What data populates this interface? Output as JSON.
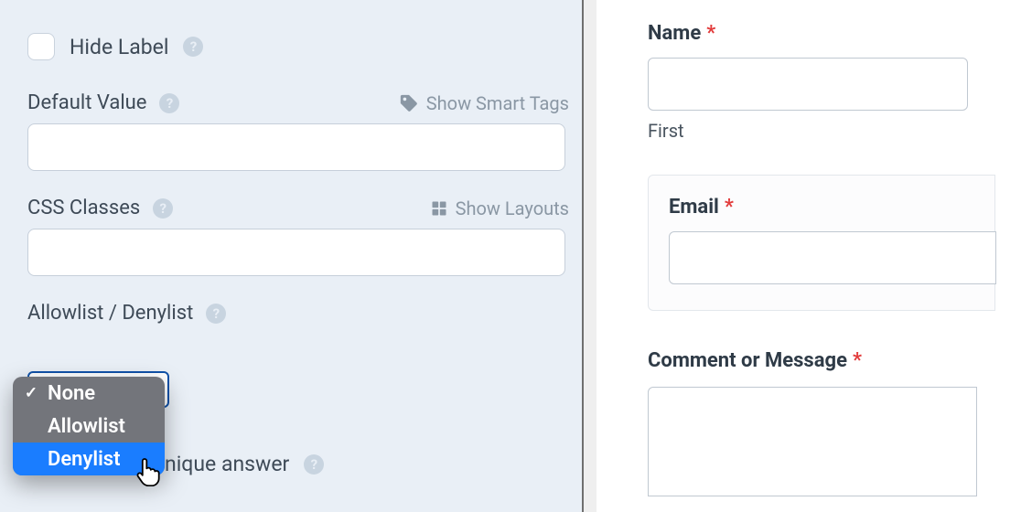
{
  "settings": {
    "hide_label": {
      "label": "Hide Label"
    },
    "default_value": {
      "label": "Default Value",
      "smart_tags_hint": "Show Smart Tags",
      "value": ""
    },
    "css_classes": {
      "label": "CSS Classes",
      "layouts_hint": "Show Layouts",
      "value": ""
    },
    "allow_deny": {
      "label": "Allowlist / Denylist",
      "options": [
        "None",
        "Allowlist",
        "Denylist"
      ],
      "selected": "None",
      "highlighted": "Denylist"
    },
    "unique_answer": {
      "label_fragment": "nique answer"
    }
  },
  "preview": {
    "name": {
      "label": "Name",
      "required": true,
      "sublabel": "First"
    },
    "email": {
      "label": "Email",
      "required": true
    },
    "comment": {
      "label": "Comment or Message",
      "required": true
    }
  },
  "glyphs": {
    "required": "*",
    "help": "?",
    "check": "✓"
  }
}
